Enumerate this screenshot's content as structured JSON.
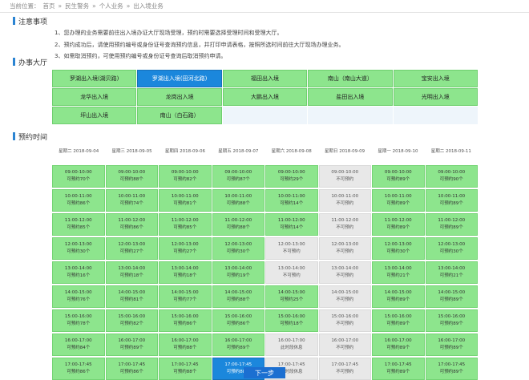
{
  "breadcrumb": [
    "当前位置：",
    "首页",
    "»",
    "民生警务",
    "»",
    "个人业务",
    "»",
    "出入境业务"
  ],
  "sections": {
    "notice": "注意事项",
    "hall": "办事大厅",
    "time": "预约时间"
  },
  "notices": [
    "1、您办理的业务需要前往出入境办证大厅现场受理，预约时需要选择受理时间和受理大厅。",
    "2、预约成功后，请使用预约编号或身份证号查询预约信息，并打印申请表格，按照所选时间前往大厅现场办理业务。",
    "3、如需取消预约，可使用预约编号或身份证号查询后取消预约申请。"
  ],
  "halls": [
    {
      "label": "罗湖出入境(湖贝路)",
      "state": "available"
    },
    {
      "label": "罗湖出入境(田河北路)",
      "state": "selected"
    },
    {
      "label": "福田出入境",
      "state": "available"
    },
    {
      "label": "南山（南山大道）",
      "state": "available"
    },
    {
      "label": "宝安出入境",
      "state": "available"
    },
    {
      "label": "龙华出入境",
      "state": "available"
    },
    {
      "label": "龙岗出入境",
      "state": "available"
    },
    {
      "label": "大鹏出入境",
      "state": "available"
    },
    {
      "label": "盐田出入境",
      "state": "available"
    },
    {
      "label": "光明出入境",
      "state": "available"
    },
    {
      "label": "坪山出入境",
      "state": "available"
    },
    {
      "label": "南山（白石路）",
      "state": "available"
    }
  ],
  "days": [
    {
      "weekday": "星期二",
      "date": "2018-09-04"
    },
    {
      "weekday": "星期三",
      "date": "2018-09-05"
    },
    {
      "weekday": "星期四",
      "date": "2018-09-06"
    },
    {
      "weekday": "星期五",
      "date": "2018-09-07"
    },
    {
      "weekday": "星期六",
      "date": "2018-09-08"
    },
    {
      "weekday": "星期日",
      "date": "2018-09-09"
    },
    {
      "weekday": "星期一",
      "date": "2018-09-10"
    },
    {
      "weekday": "星期二",
      "date": "2018-09-11"
    }
  ],
  "slot_rows": [
    {
      "time": "09:00-10:00",
      "cells": [
        [
          "可预约70个",
          "a"
        ],
        [
          "可预约88个",
          "a"
        ],
        [
          "可预约82个",
          "a"
        ],
        [
          "可预约87个",
          "a"
        ],
        [
          "可预约29个",
          "a"
        ],
        [
          "不可预约",
          "o"
        ],
        [
          "可预约89个",
          "a"
        ],
        [
          "可预约90个",
          "a"
        ]
      ]
    },
    {
      "time": "10:00-11:00",
      "cells": [
        [
          "可预约86个",
          "a"
        ],
        [
          "可预约74个",
          "a"
        ],
        [
          "可预约81个",
          "a"
        ],
        [
          "可预约88个",
          "a"
        ],
        [
          "可预约14个",
          "a"
        ],
        [
          "不可预约",
          "o"
        ],
        [
          "可预约89个",
          "a"
        ],
        [
          "可预约89个",
          "a"
        ]
      ]
    },
    {
      "time": "11:00-12:00",
      "cells": [
        [
          "可预约85个",
          "a"
        ],
        [
          "可预约86个",
          "a"
        ],
        [
          "可预约85个",
          "a"
        ],
        [
          "可预约88个",
          "a"
        ],
        [
          "可预约14个",
          "a"
        ],
        [
          "不可预约",
          "o"
        ],
        [
          "可预约89个",
          "a"
        ],
        [
          "可预约89个",
          "a"
        ]
      ]
    },
    {
      "time": "12:00-13:00",
      "cells": [
        [
          "可预约30个",
          "a"
        ],
        [
          "可预约27个",
          "a"
        ],
        [
          "可预约27个",
          "a"
        ],
        [
          "可预约30个",
          "a"
        ],
        [
          "不可预约",
          "o"
        ],
        [
          "不可预约",
          "o"
        ],
        [
          "可预约30个",
          "a"
        ],
        [
          "可预约30个",
          "a"
        ]
      ]
    },
    {
      "time": "13:00-14:00",
      "cells": [
        [
          "可预约16个",
          "a"
        ],
        [
          "可预约18个",
          "a"
        ],
        [
          "可预约18个",
          "a"
        ],
        [
          "可预约19个",
          "a"
        ],
        [
          "不可预约",
          "o"
        ],
        [
          "不可预约",
          "o"
        ],
        [
          "可预约21个",
          "a"
        ],
        [
          "可预约21个",
          "a"
        ]
      ]
    },
    {
      "time": "14:00-15:00",
      "cells": [
        [
          "可预约76个",
          "a"
        ],
        [
          "可预约81个",
          "a"
        ],
        [
          "可预约77个",
          "a"
        ],
        [
          "可预约88个",
          "a"
        ],
        [
          "可预约25个",
          "a"
        ],
        [
          "不可预约",
          "o"
        ],
        [
          "可预约89个",
          "a"
        ],
        [
          "可预约89个",
          "a"
        ]
      ]
    },
    {
      "time": "15:00-16:00",
      "cells": [
        [
          "可预约78个",
          "a"
        ],
        [
          "可预约82个",
          "a"
        ],
        [
          "可预约86个",
          "a"
        ],
        [
          "可预约86个",
          "a"
        ],
        [
          "可预约18个",
          "a"
        ],
        [
          "不可预约",
          "o"
        ],
        [
          "可预约89个",
          "a"
        ],
        [
          "可预约89个",
          "a"
        ]
      ]
    },
    {
      "time": "16:00-17:00",
      "cells": [
        [
          "可预约84个",
          "a"
        ],
        [
          "可预约89个",
          "a"
        ],
        [
          "可预约88个",
          "a"
        ],
        [
          "可预约89个",
          "a"
        ],
        [
          "此时段休息",
          "o"
        ],
        [
          "不可预约",
          "o"
        ],
        [
          "可预约89个",
          "a"
        ],
        [
          "可预约89个",
          "a"
        ]
      ]
    },
    {
      "time": "17:00-17:45",
      "cells": [
        [
          "可预约86个",
          "a"
        ],
        [
          "可预约86个",
          "a"
        ],
        [
          "可预约88个",
          "a"
        ],
        [
          "可预约88个",
          "s"
        ],
        [
          "此时段休息",
          "o"
        ],
        [
          "不可预约",
          "o"
        ],
        [
          "可预约89个",
          "a"
        ],
        [
          "可预约89个",
          "a"
        ]
      ]
    }
  ],
  "next_button": "下一步"
}
